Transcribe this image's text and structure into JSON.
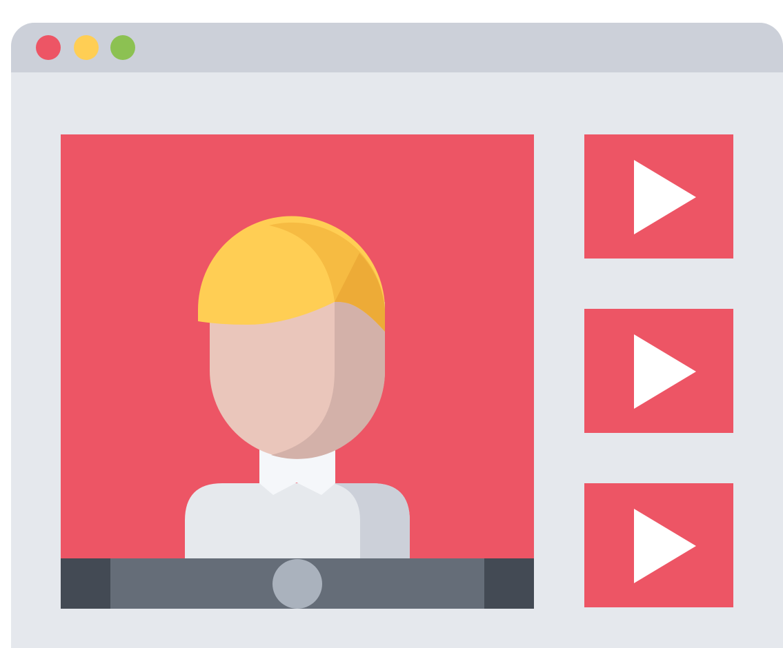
{
  "colors": {
    "page_background": "#ffffff",
    "window_background": "#e5e8ed",
    "titlebar": "#ccd0d9",
    "close_dot": "#ed5565",
    "minimize_dot": "#ffce54",
    "maximize_dot": "#8cc152",
    "video_background": "#ed5565",
    "hair_light": "#ffce54",
    "hair_mid": "#f6bb42",
    "hair_dark": "#edab37",
    "skin_light": "#eac6bb",
    "skin_shadow": "#d3b1a9",
    "collar": "#f5f7fa",
    "shirt_light": "#e6e9ed",
    "shirt_shadow": "#ccd0d9",
    "controlbar": "#656d78",
    "controlbar_caps": "#434a54",
    "scrubber_knob": "#aab2bd",
    "thumbnail_background": "#ed5565",
    "play_icon": "#ffffff"
  },
  "window_controls": [
    {
      "name": "close",
      "icon": "red-circle"
    },
    {
      "name": "minimize",
      "icon": "yellow-circle"
    },
    {
      "name": "maximize",
      "icon": "green-circle"
    }
  ],
  "video": {
    "icon": "person-avatar-icon",
    "scrubber_position": 0.5
  },
  "thumbnails": [
    {
      "icon": "play-icon"
    },
    {
      "icon": "play-icon"
    },
    {
      "icon": "play-icon"
    }
  ]
}
